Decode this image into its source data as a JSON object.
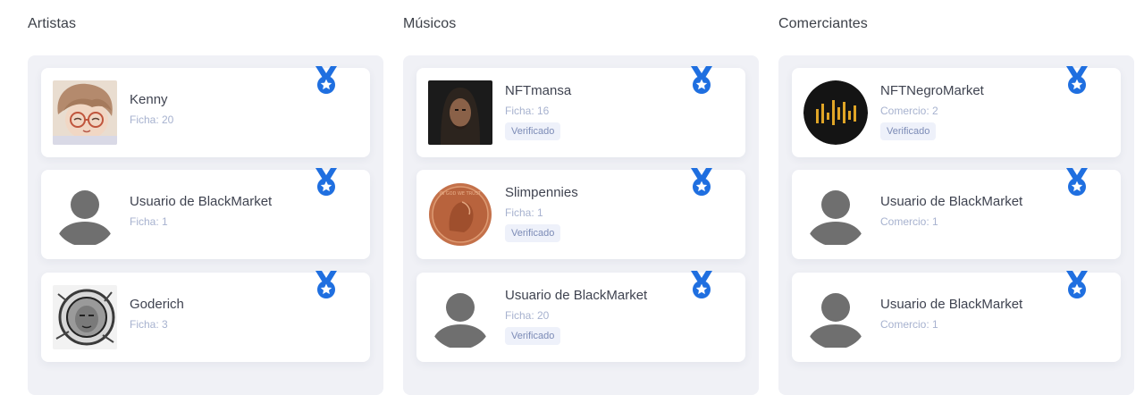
{
  "columns": [
    {
      "title": "Artistas",
      "cards": [
        {
          "name": "Kenny",
          "stat": "Ficha: 20",
          "verified": "",
          "avatar": "anime-avatar-image"
        },
        {
          "name": "Usuario de BlackMarket",
          "stat": "Ficha: 1",
          "verified": "",
          "avatar": "default-user-avatar"
        },
        {
          "name": "Goderich",
          "stat": "Ficha: 3",
          "verified": "",
          "avatar": "astronaut-sketch-image"
        }
      ]
    },
    {
      "title": "Músicos",
      "cards": [
        {
          "name": "NFTmansa",
          "stat": "Ficha: 16",
          "verified": "Verificado",
          "avatar": "portrait-photo-image"
        },
        {
          "name": "Slimpennies",
          "stat": "Ficha: 1",
          "verified": "Verificado",
          "avatar": "penny-coin-image"
        },
        {
          "name": "Usuario de BlackMarket",
          "stat": "Ficha: 20",
          "verified": "Verificado",
          "avatar": "default-user-avatar"
        }
      ]
    },
    {
      "title": "Comerciantes",
      "cards": [
        {
          "name": "NFTNegroMarket",
          "stat": "Comercio: 2",
          "verified": "Verificado",
          "avatar": "equalizer-logo"
        },
        {
          "name": "Usuario de BlackMarket",
          "stat": "Comercio: 1",
          "verified": "",
          "avatar": "default-user-avatar"
        },
        {
          "name": "Usuario de BlackMarket",
          "stat": "Comercio: 1",
          "verified": "",
          "avatar": "default-user-avatar"
        }
      ]
    }
  ],
  "icons": {
    "badge": "medal-star-icon"
  },
  "colors": {
    "medal": "#1f6fe0",
    "panel": "#f0f1f6",
    "muted_text": "#a7b2cf",
    "verified_bg": "#eef1fa"
  }
}
